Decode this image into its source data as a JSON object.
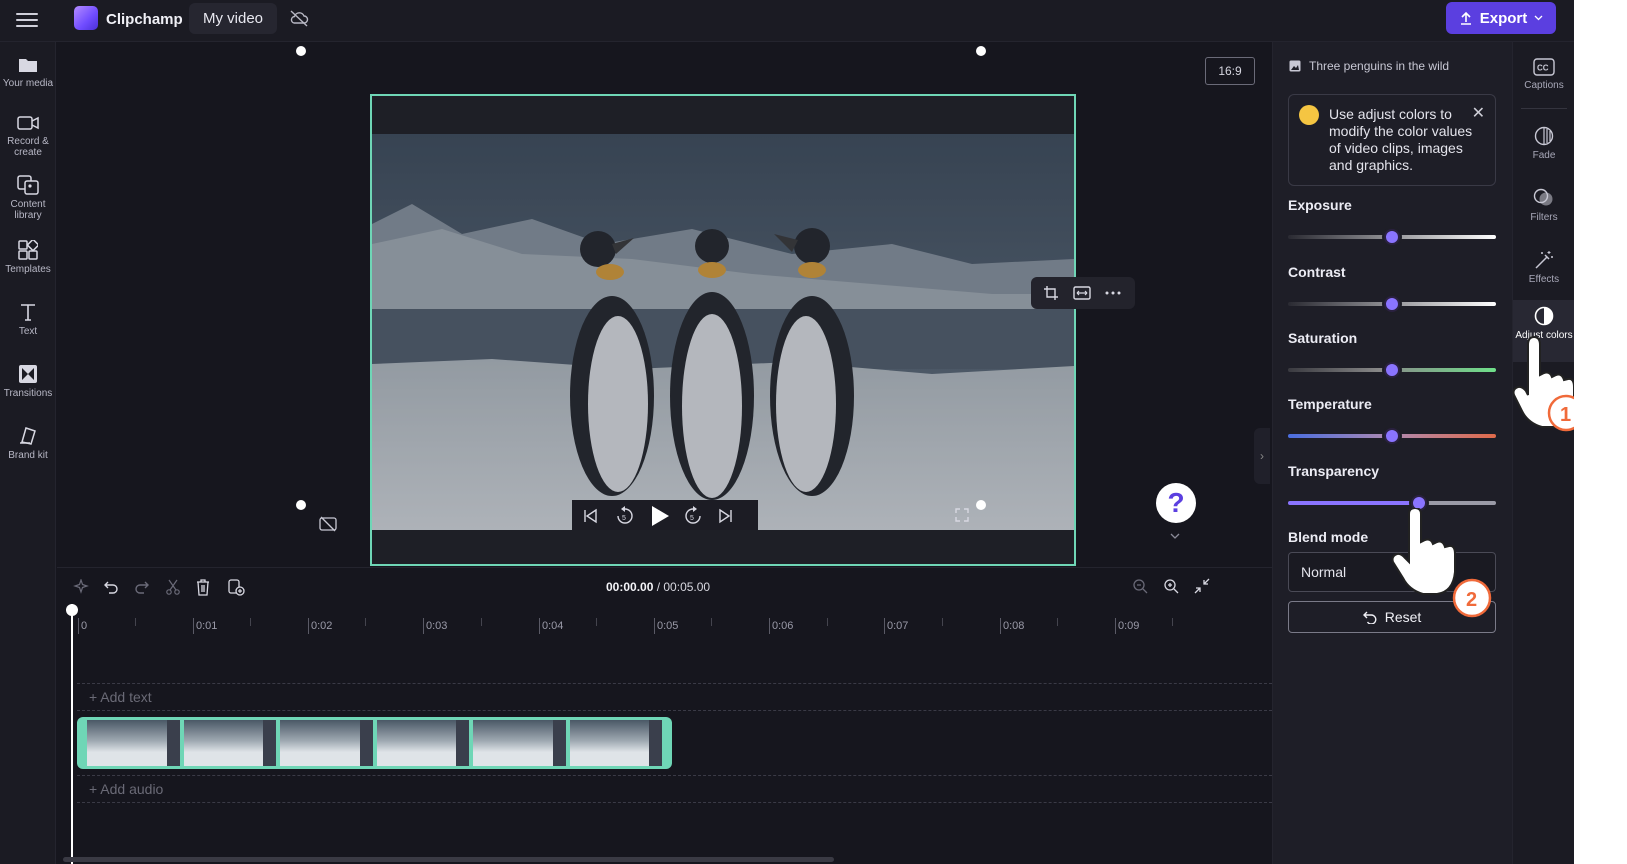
{
  "topbar": {
    "brand": "Clipchamp",
    "video_title": "My video",
    "export_label": "Export"
  },
  "left_sidebar": {
    "items": [
      {
        "label": "Your media",
        "icon": "folder-icon"
      },
      {
        "label": "Record & create",
        "icon": "camera-icon"
      },
      {
        "label": "Content library",
        "icon": "library-icon"
      },
      {
        "label": "Templates",
        "icon": "templates-icon"
      },
      {
        "label": "Text",
        "icon": "text-icon"
      },
      {
        "label": "Transitions",
        "icon": "transitions-icon"
      },
      {
        "label": "Brand kit",
        "icon": "brand-kit-icon"
      }
    ]
  },
  "preview": {
    "aspect_ratio": "16:9"
  },
  "timeline": {
    "current_time": "00:00.00",
    "total_time": "/ 00:05.00",
    "ruler_labels": [
      "0",
      "0:01",
      "0:02",
      "0:03",
      "0:04",
      "0:05",
      "0:06",
      "0:07",
      "0:08",
      "0:09"
    ],
    "add_text_label": "+ Add text",
    "add_audio_label": "+ Add audio",
    "clip_thumbnail_count": 6
  },
  "panel": {
    "asset_title": "Three penguins in the wild",
    "tip_text": "Use adjust colors to modify the color values of video clips, images and graphics.",
    "sliders": [
      {
        "label": "Exposure",
        "value": 0.5
      },
      {
        "label": "Contrast",
        "value": 0.5
      },
      {
        "label": "Saturation",
        "value": 0.5
      },
      {
        "label": "Temperature",
        "value": 0.5
      },
      {
        "label": "Transparency",
        "value": 0.63
      }
    ],
    "blend_mode_label": "Blend mode",
    "blend_mode_value": "Normal",
    "reset_label": "Reset"
  },
  "right_rail": {
    "items": [
      {
        "label": "Captions",
        "icon": "captions-icon"
      },
      {
        "label": "Fade",
        "icon": "fade-icon"
      },
      {
        "label": "Filters",
        "icon": "filters-icon"
      },
      {
        "label": "Effects",
        "icon": "effects-icon"
      },
      {
        "label": "Adjust colors",
        "icon": "adjust-colors-icon",
        "active": true
      }
    ]
  },
  "annotations": {
    "step_1": "1",
    "step_2": "2"
  },
  "colors": {
    "accent": "#5b3fe0",
    "selection": "#6fd6b6",
    "slider_knob": "#8a74ff"
  }
}
